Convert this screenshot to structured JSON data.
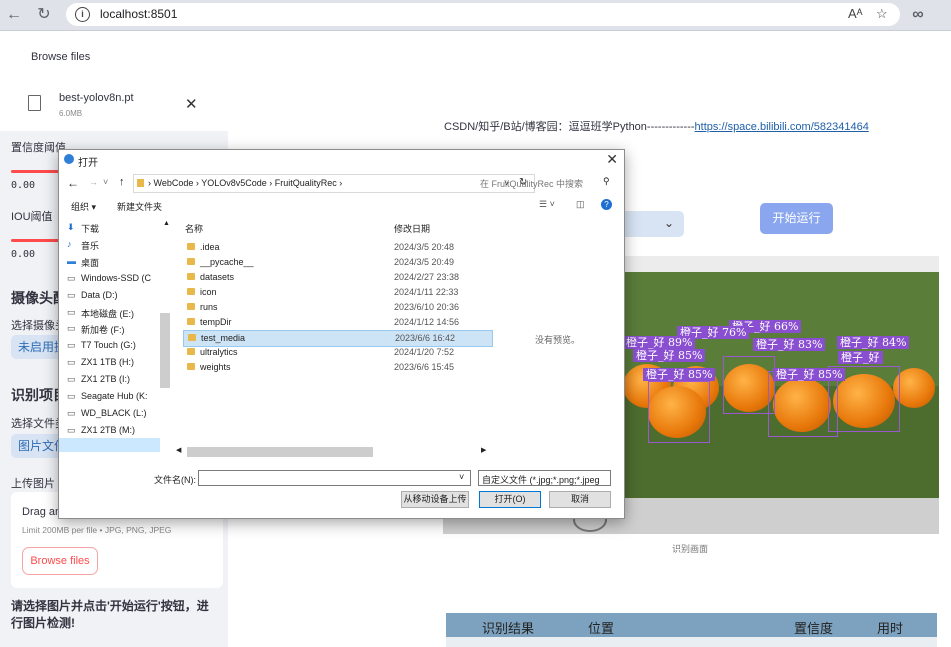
{
  "browser": {
    "url": "localhost:8501",
    "reader_icon": "Aᴬ",
    "back_icon": "arrow-left-icon",
    "refresh_icon": "refresh-icon",
    "favorite_icon": "star-icon",
    "extensions_icon": "infinity-icon"
  },
  "sidebar": {
    "browse_files_top": "Browse files",
    "file_name": "best-yolov8n.pt",
    "file_size": "6.0MB",
    "conf_label": "置信度阈值",
    "conf_value": "0.00",
    "iou_label": "IOU阈值",
    "iou_value": "0.00",
    "camera_heading": "摄像头配置",
    "camera_select_label": "选择摄像头",
    "camera_select_value": "未启用摄像头",
    "recognition_heading": "识别项目设置",
    "file_type_label": "选择文件类型",
    "file_type_value": "图片文件",
    "upload_label": "上传图片",
    "drag_text": "Drag and drop file here",
    "limit_text": "Limit 200MB per file • JPG, PNG, JPEG",
    "browse_button": "Browse files",
    "hint_text": "请选择图片并点击'开始运行'按钮，进行图片检测!"
  },
  "main": {
    "credit_text": "CSDN/知乎/B站/博客园：逗逗班学Python-------------",
    "credit_link": "https://space.bilibili.com/582341464",
    "run_button": "开始运行",
    "image_caption": "识别画面",
    "detections": [
      {
        "label": "橙子_好",
        "conf": "66%"
      },
      {
        "label": "橙子_好",
        "conf": "76%"
      },
      {
        "label": "橙子_好",
        "conf": "83%"
      },
      {
        "label": "橙子_好",
        "conf": "84%"
      },
      {
        "label": "橙子_好",
        "conf": "89%"
      },
      {
        "label": "橙子_好",
        "conf": "85%"
      },
      {
        "label": "橙子_好",
        "conf": "85%"
      },
      {
        "label": "橙子_好",
        "conf": ""
      }
    ],
    "table_headers": [
      "识别结果",
      "位置",
      "置信度",
      "用时"
    ]
  },
  "dialog": {
    "title": "打开",
    "path": [
      "WebCode",
      "YOLOv8v5Code",
      "FruitQualityRec"
    ],
    "search_placeholder": "在 FruitQualityRec 中搜索",
    "organize": "组织 ▾",
    "new_folder": "新建文件夹",
    "col_name": "名称",
    "col_date": "修改日期",
    "no_preview": "没有预览。",
    "tree": [
      {
        "icon": "download-icon",
        "label": "下载"
      },
      {
        "icon": "music-icon",
        "label": "音乐"
      },
      {
        "icon": "desktop-icon",
        "label": "桌面"
      },
      {
        "icon": "drive-icon",
        "label": "Windows-SSD (C"
      },
      {
        "icon": "drive-icon",
        "label": "Data (D:)"
      },
      {
        "icon": "drive-icon",
        "label": "本地磁盘 (E:)"
      },
      {
        "icon": "drive-icon",
        "label": "新加卷 (F:)"
      },
      {
        "icon": "drive-icon",
        "label": "T7 Touch (G:)"
      },
      {
        "icon": "drive-icon",
        "label": "ZX1 1TB (H:)"
      },
      {
        "icon": "drive-icon",
        "label": "ZX1 2TB (I:)"
      },
      {
        "icon": "drive-icon",
        "label": "Seagate Hub (K:"
      },
      {
        "icon": "drive-icon",
        "label": "WD_BLACK (L:)"
      },
      {
        "icon": "drive-icon",
        "label": "ZX1 2TB (M:)"
      },
      {
        "icon": "drive-icon",
        "label": "ZX1 4TB (N:)"
      }
    ],
    "files": [
      {
        "name": ".idea",
        "date": "2024/3/5 20:48"
      },
      {
        "name": "__pycache__",
        "date": "2024/3/5 20:49"
      },
      {
        "name": "datasets",
        "date": "2024/2/27 23:38"
      },
      {
        "name": "icon",
        "date": "2024/1/11 22:33"
      },
      {
        "name": "runs",
        "date": "2023/6/10 20:36"
      },
      {
        "name": "tempDir",
        "date": "2024/1/12 14:56"
      },
      {
        "name": "test_media",
        "date": "2023/6/6 16:42"
      },
      {
        "name": "ultralytics",
        "date": "2024/1/20 7:52"
      },
      {
        "name": "weights",
        "date": "2023/6/6 15:45"
      }
    ],
    "filename_label": "文件名(N):",
    "filename_value": "",
    "filter_value": "自定义文件 (*.jpg;*.png;*.jpeg",
    "upload_from_device": "从移动设备上传",
    "open_button": "打开(O)",
    "cancel_button": "取消"
  }
}
